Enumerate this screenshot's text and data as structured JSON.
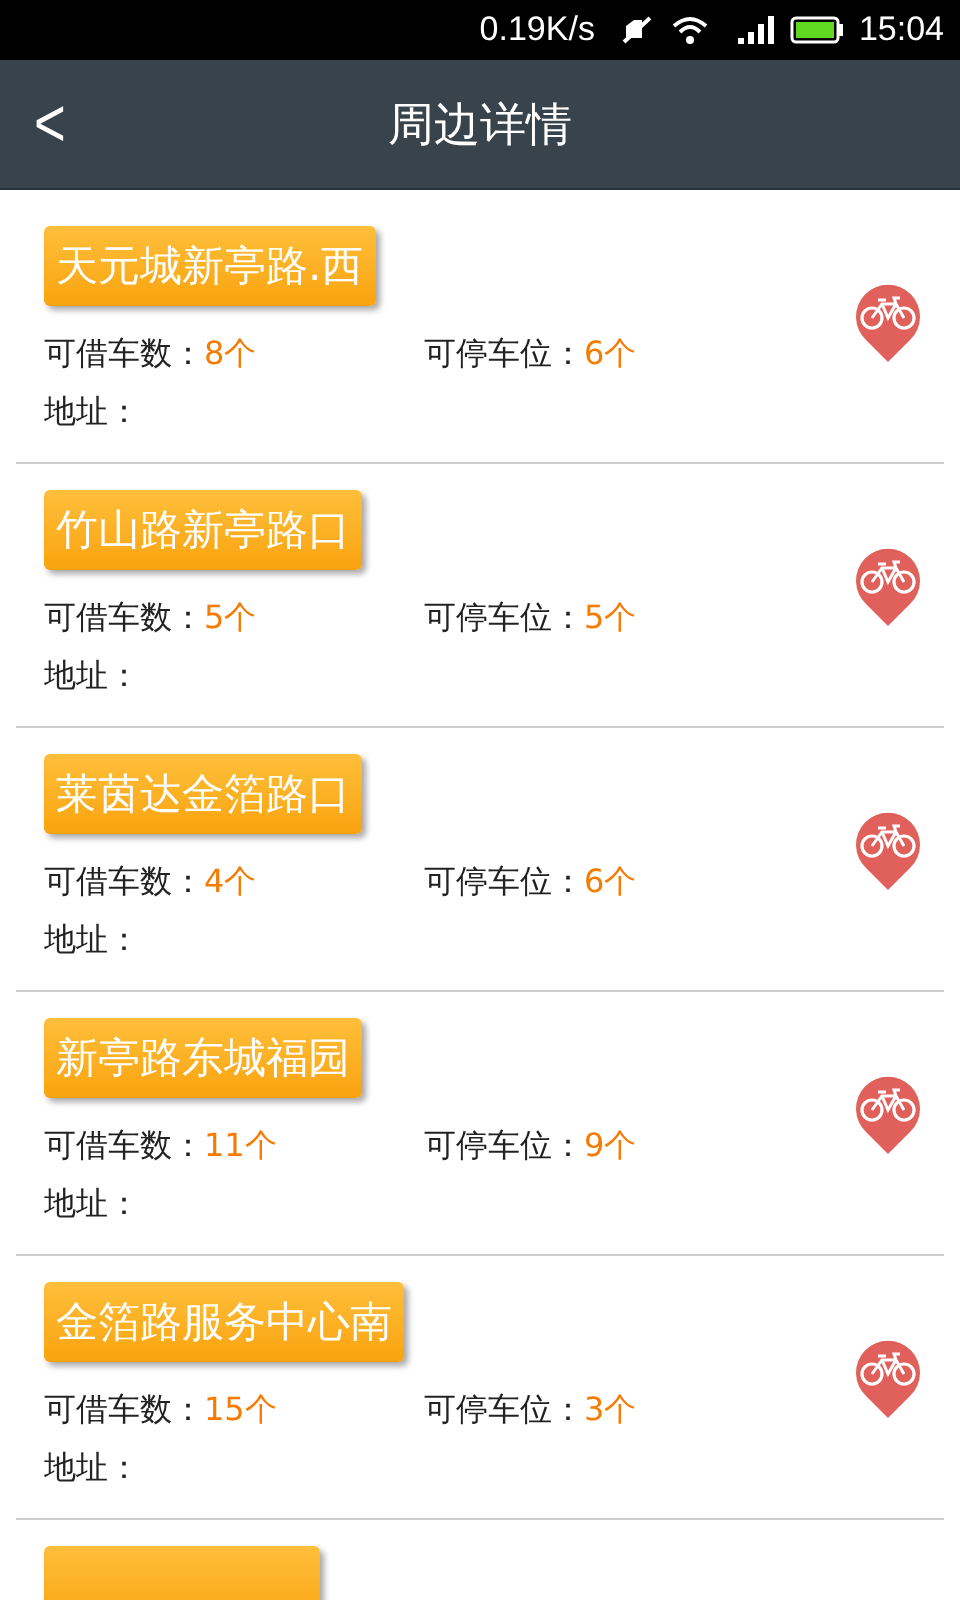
{
  "status_bar": {
    "speed": "0.19K/s",
    "time": "15:04"
  },
  "header": {
    "back": "<",
    "title": "周边详情"
  },
  "stations": [
    {
      "name": "天元城新亭路.西",
      "bikes_label": "可借车数：",
      "bikes": "8个",
      "docks_label": "可停车位：",
      "docks": "6个",
      "address_label": "地址："
    },
    {
      "name": "竹山路新亭路口",
      "bikes_label": "可借车数：",
      "bikes": "5个",
      "docks_label": "可停车位：",
      "docks": "5个",
      "address_label": "地址："
    },
    {
      "name": "莱茵达金箔路口",
      "bikes_label": "可借车数：",
      "bikes": "4个",
      "docks_label": "可停车位：",
      "docks": "6个",
      "address_label": "地址："
    },
    {
      "name": "新亭路东城福园",
      "bikes_label": "可借车数：",
      "bikes": "11个",
      "docks_label": "可停车位：",
      "docks": "9个",
      "address_label": "地址："
    },
    {
      "name": "金箔路服务中心南",
      "bikes_label": "可借车数：",
      "bikes": "15个",
      "docks_label": "可停车位：",
      "docks": "3个",
      "address_label": "地址："
    },
    {
      "kind": "partial"
    }
  ]
}
